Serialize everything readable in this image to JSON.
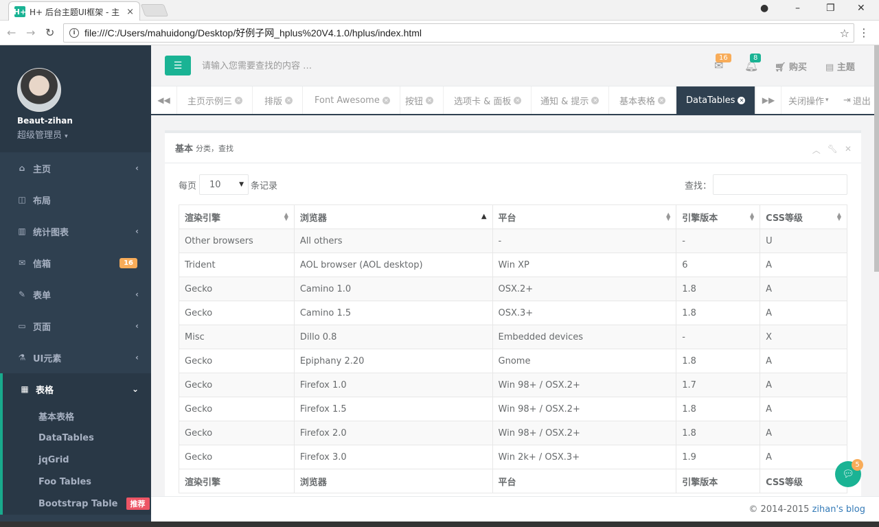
{
  "browser": {
    "tab_favicon": "H+",
    "tab_title": "H+ 后台主题UI框架 - 主",
    "tab_close": "×",
    "url": "file:///C:/Users/mahuidong/Desktop/好例子网_hplus%20V4.1.0/hplus/index.html",
    "icons": [
      "back-icon",
      "forward-icon",
      "reload-icon",
      "info-icon",
      "star-icon",
      "menu-icon",
      "account-icon",
      "minimize-icon",
      "restore-icon",
      "close-icon"
    ]
  },
  "sidebar": {
    "user_name": "Beaut-zihan",
    "user_role": "超级管理员",
    "items": [
      {
        "label": "主页",
        "icon": "home-icon",
        "arrow": "‹"
      },
      {
        "label": "布局",
        "icon": "columns-icon",
        "arrow": ""
      },
      {
        "label": "统计图表",
        "icon": "bar-chart-icon",
        "arrow": "‹"
      },
      {
        "label": "信箱",
        "icon": "envelope-icon",
        "badge": "16"
      },
      {
        "label": "表单",
        "icon": "edit-icon",
        "arrow": "‹"
      },
      {
        "label": "页面",
        "icon": "desktop-icon",
        "arrow": "‹"
      },
      {
        "label": "UI元素",
        "icon": "flask-icon",
        "arrow": "‹"
      },
      {
        "label": "表格",
        "icon": "table-icon",
        "arrow": "⌄"
      }
    ],
    "sub_items": [
      "基本表格",
      "DataTables",
      "jqGrid",
      "Foo Tables",
      "Bootstrap Table"
    ],
    "sub_tag": "推荐"
  },
  "topbar": {
    "search_placeholder": "请输入您需要查找的内容 …",
    "mail_count": "16",
    "bell_count": "8",
    "buy_label": "购买",
    "theme_label": "主题",
    "accent": "#1ab394"
  },
  "content_tabs": {
    "tabs": [
      "主页示例三",
      "排版",
      "Font Awesome",
      "按钮",
      "选项卡 & 面板",
      "通知 & 提示",
      "基本表格",
      "DataTables"
    ],
    "close_ops": "关闭操作",
    "logout": "退出"
  },
  "panel": {
    "title": "基本",
    "subtitle": "分类，查找",
    "per_page_prefix": "每页",
    "per_page_value": "10",
    "per_page_suffix": "条记录",
    "search_label": "查找："
  },
  "table": {
    "headers": [
      "渲染引擎",
      "浏览器",
      "平台",
      "引擎版本",
      "CSS等级"
    ],
    "rows": [
      [
        "Other browsers",
        "All others",
        "-",
        "-",
        "U"
      ],
      [
        "Trident",
        "AOL browser (AOL desktop)",
        "Win XP",
        "6",
        "A"
      ],
      [
        "Gecko",
        "Camino 1.0",
        "OSX.2+",
        "1.8",
        "A"
      ],
      [
        "Gecko",
        "Camino 1.5",
        "OSX.3+",
        "1.8",
        "A"
      ],
      [
        "Misc",
        "Dillo 0.8",
        "Embedded devices",
        "-",
        "X"
      ],
      [
        "Gecko",
        "Epiphany 2.20",
        "Gnome",
        "1.8",
        "A"
      ],
      [
        "Gecko",
        "Firefox 1.0",
        "Win 98+ / OSX.2+",
        "1.7",
        "A"
      ],
      [
        "Gecko",
        "Firefox 1.5",
        "Win 98+ / OSX.2+",
        "1.8",
        "A"
      ],
      [
        "Gecko",
        "Firefox 2.0",
        "Win 98+ / OSX.2+",
        "1.8",
        "A"
      ],
      [
        "Gecko",
        "Firefox 3.0",
        "Win 2k+ / OSX.3+",
        "1.9",
        "A"
      ]
    ]
  },
  "footer": {
    "copyright": "© 2014-2015",
    "link": "zihan's blog"
  },
  "chat": {
    "count": "5"
  }
}
